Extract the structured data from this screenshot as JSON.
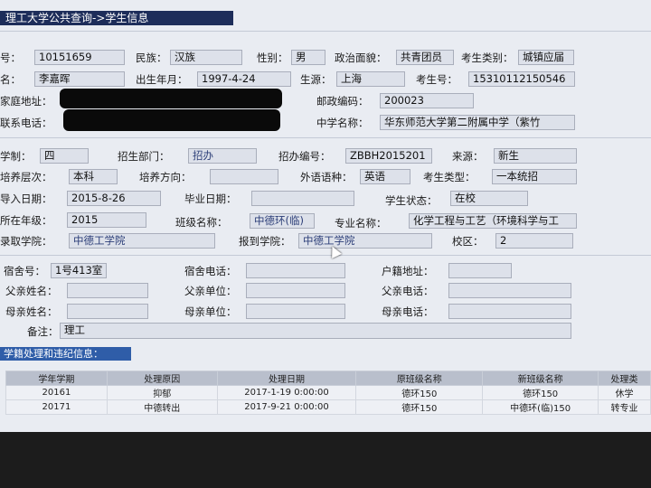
{
  "header": {
    "title": "理工大学公共查询->学生信息"
  },
  "basic": {
    "student_id_label": "号：",
    "student_id": "10151659",
    "ethnicity_label": "民族：",
    "ethnicity": "汉族",
    "gender_label": "性别：",
    "gender": "男",
    "political_label": "政治面貌：",
    "political": "共青团员",
    "category_label": "考生类别：",
    "category": "城镇应届",
    "name_label": "名：",
    "name": "李嘉晖",
    "birth_label": "出生年月：",
    "birth": "1997-4-24",
    "origin_label": "生源：",
    "origin": "上海",
    "exam_no_label": "考生号：",
    "exam_no": "15310112150546",
    "address_label": "家庭地址：",
    "postcode_label": "邮政编码：",
    "postcode": "200023",
    "phone_label": "联系电话：",
    "school_label": "中学名称：",
    "school": "华东师范大学第二附属中学（紫竹"
  },
  "enrollment": {
    "duration_label": "学制：",
    "duration": "四",
    "dept_label": "招生部门：",
    "dept": "招办",
    "code_label": "招办编号：",
    "code": "ZBBH2015201",
    "source_label": "来源：",
    "source": "新生",
    "level_label": "培养层次：",
    "level": "本科",
    "direction_label": "培养方向：",
    "direction": "",
    "language_label": "外语语种：",
    "language": "英语",
    "exam_type_label": "考生类型：",
    "exam_type": "一本统招",
    "import_date_label": "导入日期：",
    "import_date": "2015-8-26",
    "grad_date_label": "毕业日期：",
    "grad_date": "",
    "status_label": "学生状态：",
    "status": "在校",
    "grade_label": "所在年级：",
    "grade": "2015",
    "class_label": "班级名称：",
    "class_name": "中德环(临)",
    "major_label": "专业名称：",
    "major": "化学工程与工艺（环境科学与工",
    "admit_college_label": "录取学院：",
    "admit_college": "中德工学院",
    "report_college_label": "报到学院：",
    "report_college": "中德工学院",
    "campus_label": "校区：",
    "campus": "2"
  },
  "family": {
    "dorm_label": "宿舍号：",
    "dorm": "1号413室",
    "dorm_phone_label": "宿舍电话：",
    "dorm_phone": "",
    "hukou_label": "户籍地址：",
    "hukou": "",
    "father_name_label": "父亲姓名：",
    "father_name": "",
    "father_work_label": "父亲单位：",
    "father_work": "",
    "father_phone_label": "父亲电话：",
    "father_phone": "",
    "mother_name_label": "母亲姓名：",
    "mother_name": "",
    "mother_work_label": "母亲单位：",
    "mother_work": "",
    "mother_phone_label": "母亲电话：",
    "mother_phone": "",
    "remark_label": "备注：",
    "remark": "理工"
  },
  "records": {
    "title": "学籍处理和违纪信息：",
    "columns": [
      "学年学期",
      "处理原因",
      "处理日期",
      "原班级名称",
      "新班级名称",
      "处理类"
    ],
    "rows": [
      [
        "20161",
        "抑郁",
        "2017-1-19 0:00:00",
        "德环150",
        "德环150",
        "休学"
      ],
      [
        "20171",
        "中德转出",
        "2017-9-21 0:00:00",
        "德环150",
        "中德环(临)150",
        "转专业"
      ]
    ]
  }
}
